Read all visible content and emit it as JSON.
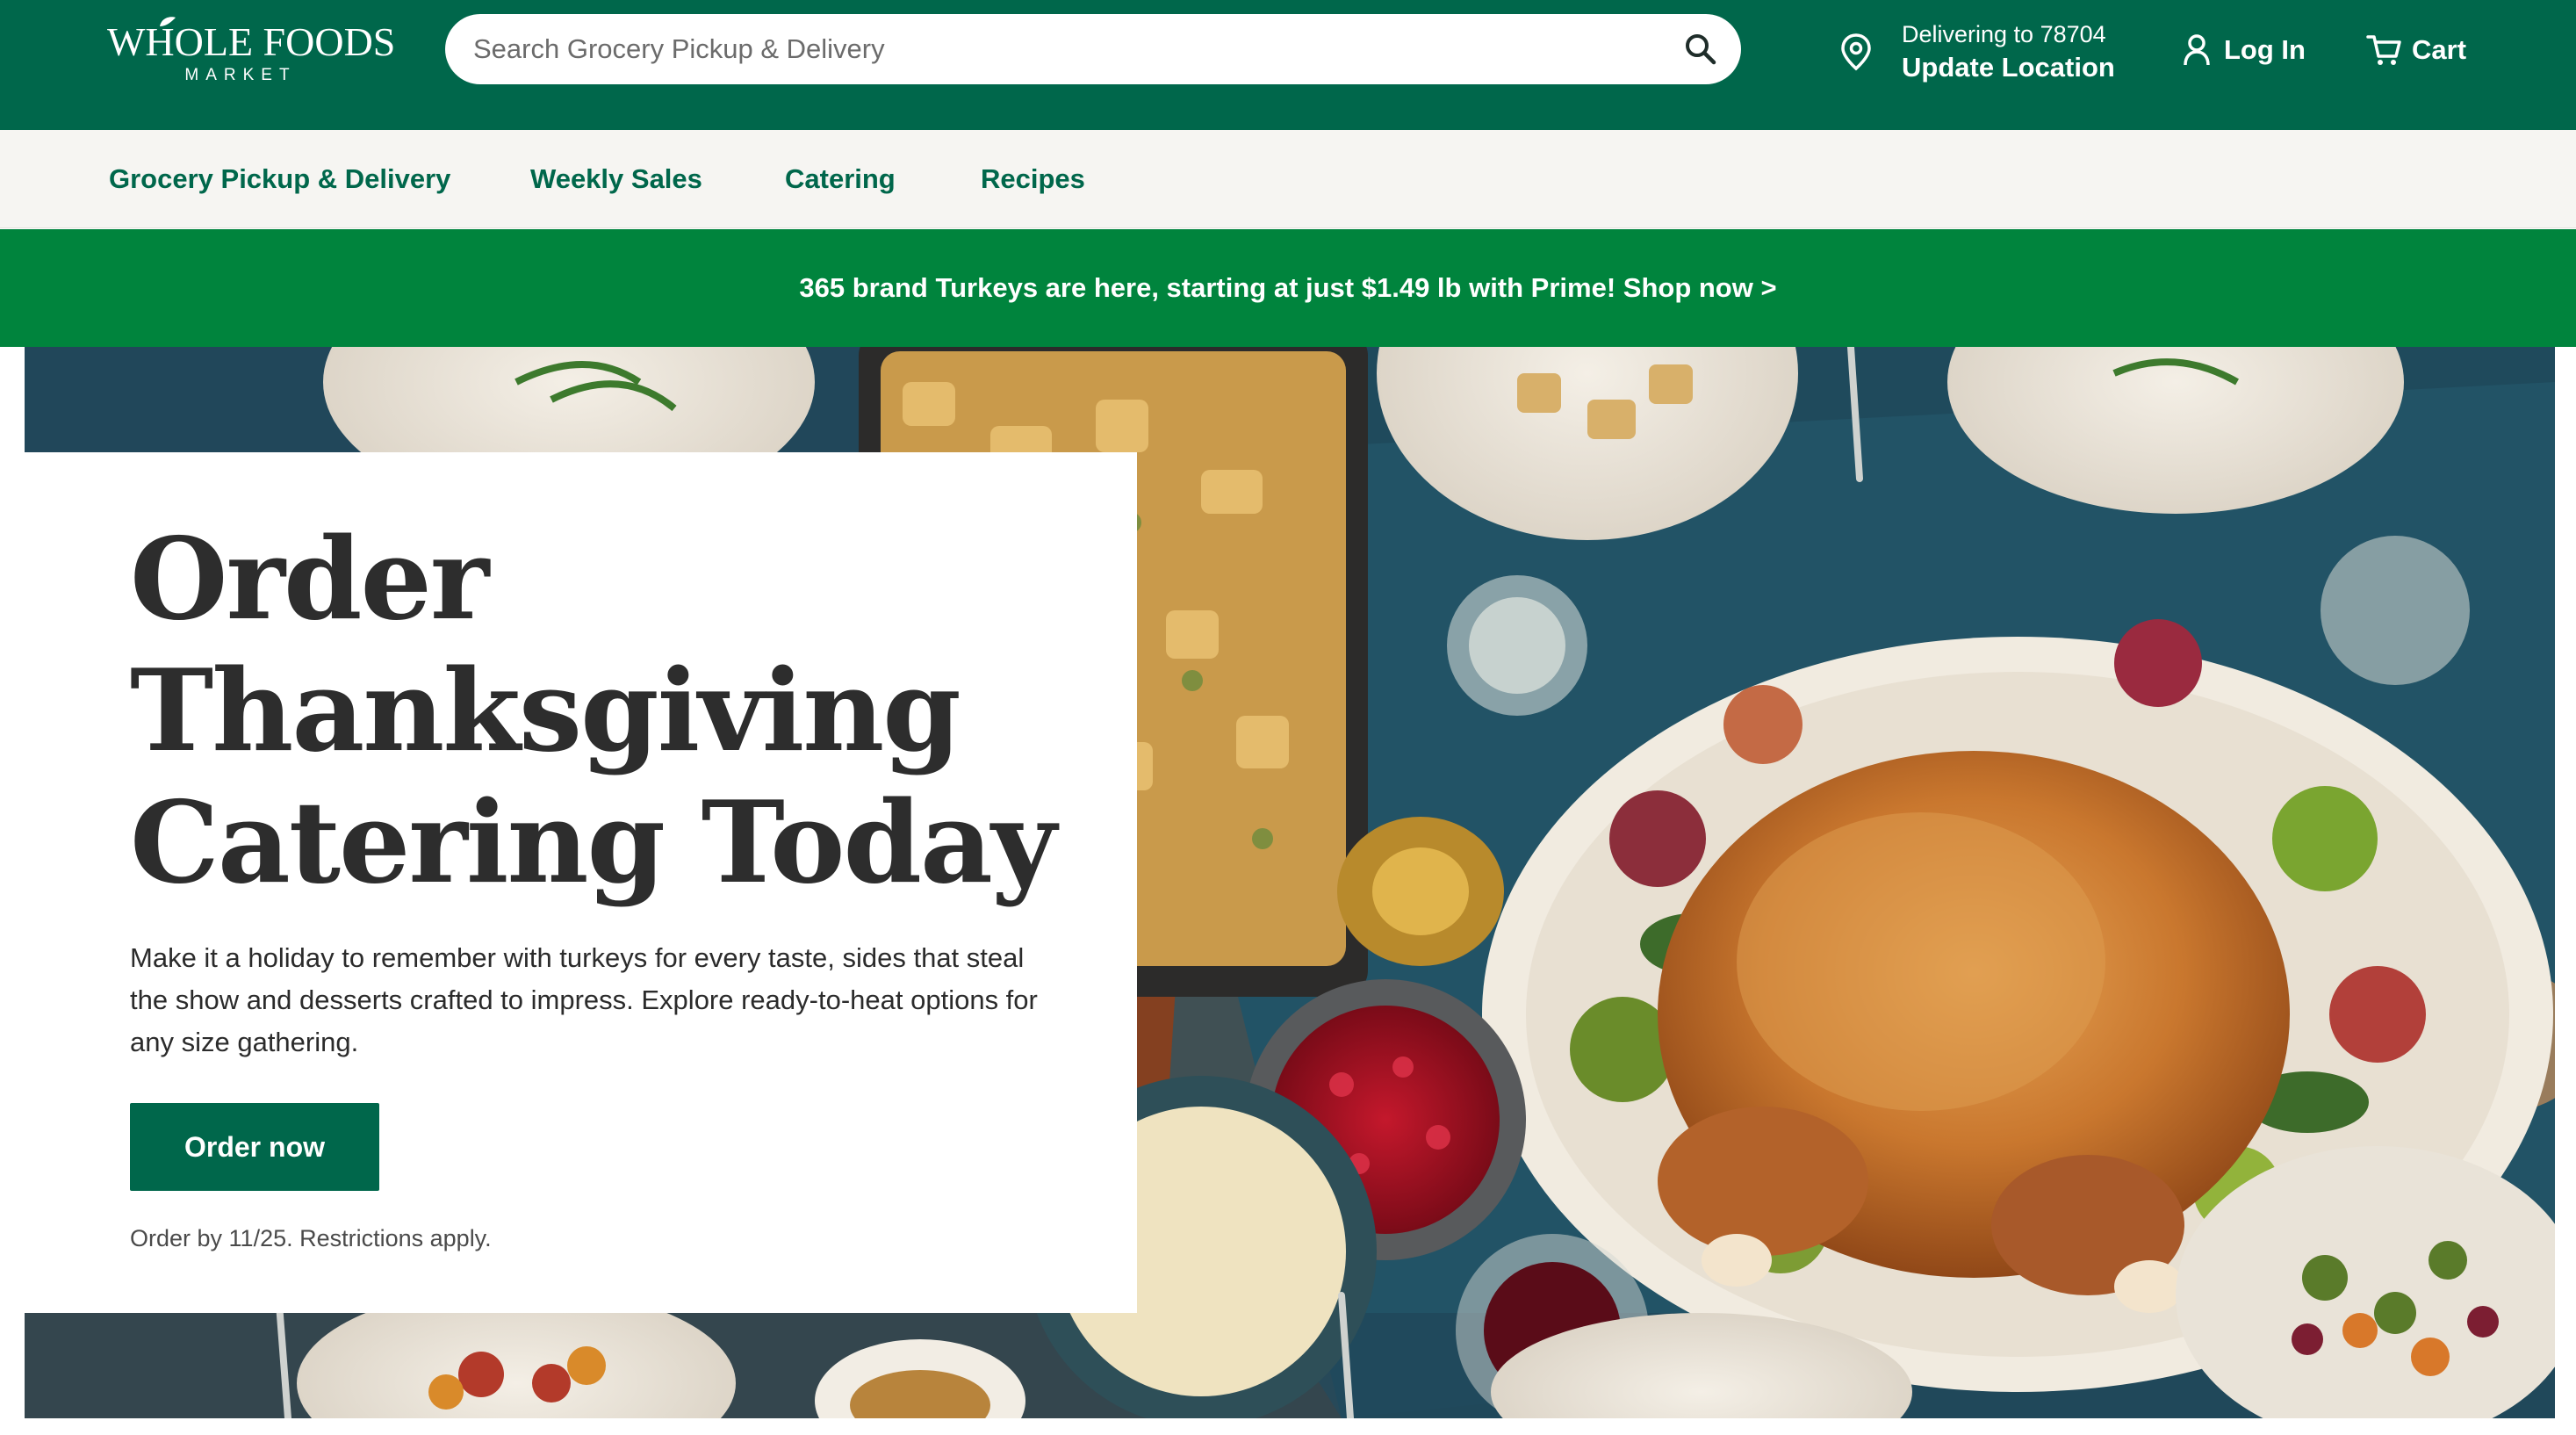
{
  "header": {
    "logo_line1": "WHOLE FOODS",
    "logo_line2": "MARKET",
    "search_placeholder": "Search Grocery Pickup & Delivery",
    "search_icon": "search-icon",
    "location": {
      "icon": "map-pin-icon",
      "delivering_label": "Delivering to 78704",
      "update_label": "Update Location"
    },
    "login": {
      "icon": "user-icon",
      "label": "Log In"
    },
    "cart": {
      "icon": "cart-icon",
      "label": "Cart"
    }
  },
  "nav": {
    "items": [
      {
        "label": "Grocery Pickup & Delivery"
      },
      {
        "label": "Weekly Sales"
      },
      {
        "label": "Catering"
      },
      {
        "label": "Recipes"
      }
    ]
  },
  "promo": {
    "text": "365 brand Turkeys are here, starting at just $1.49 lb with Prime! Shop now >"
  },
  "hero": {
    "title_lines": [
      "Order",
      "Thanksgiving",
      "Catering Today"
    ],
    "body": "Make it a holiday to remember with turkeys for every taste, sides that steal the show and desserts crafted to impress. Explore ready-to-heat options for any size gathering.",
    "button_label": "Order now",
    "note": "Order by 11/25. Restrictions apply."
  },
  "colors": {
    "brand_green": "#00674b",
    "promo_green": "#00843d",
    "nav_bg": "#f6f5f2"
  }
}
